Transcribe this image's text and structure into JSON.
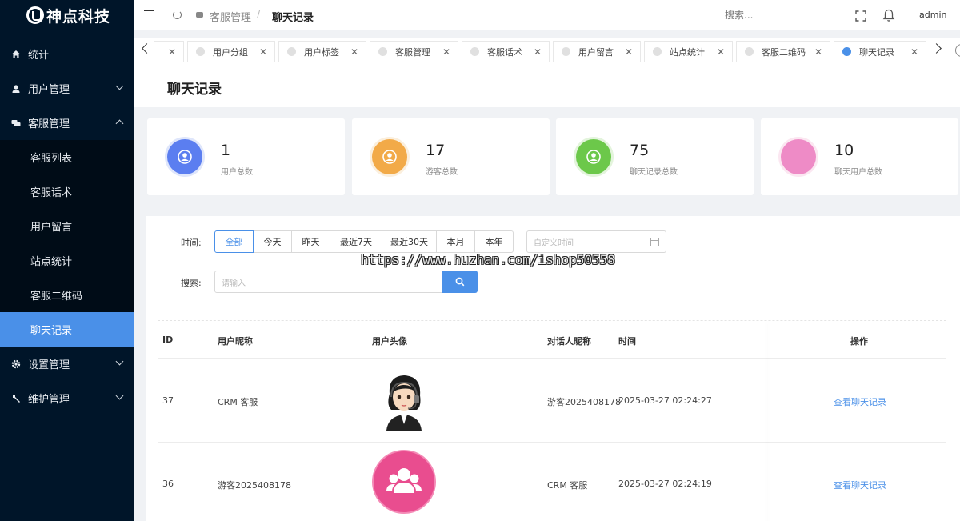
{
  "app": {
    "logo_text": "神点科技"
  },
  "sidebar": {
    "items": [
      {
        "label": "统计",
        "icon": "home-icon"
      },
      {
        "label": "用户管理",
        "icon": "user-icon"
      },
      {
        "label": "客服管理",
        "icon": "chat-icon"
      }
    ],
    "sub_items": [
      "客服列表",
      "客服话术",
      "用户留言",
      "站点统计",
      "客服二维码",
      "聊天记录"
    ],
    "active_sub": "聊天记录",
    "bottom_items": [
      {
        "label": "设置管理",
        "icon": "gear-icon"
      },
      {
        "label": "维护管理",
        "icon": "tool-icon"
      }
    ]
  },
  "header": {
    "breadcrumb_parent": "客服管理",
    "breadcrumb_sep": "/",
    "breadcrumb_current": "聊天记录",
    "search_placeholder": "搜索...",
    "user": "admin"
  },
  "tabs": [
    {
      "label": "",
      "active": false
    },
    {
      "label": "用户分组",
      "active": false
    },
    {
      "label": "用户标签",
      "active": false
    },
    {
      "label": "客服管理",
      "active": false
    },
    {
      "label": "客服话术",
      "active": false
    },
    {
      "label": "用户留言",
      "active": false
    },
    {
      "label": "站点统计",
      "active": false
    },
    {
      "label": "客服二维码",
      "active": false
    },
    {
      "label": "聊天记录",
      "active": true
    }
  ],
  "page": {
    "title": "聊天记录"
  },
  "stats": [
    {
      "value": "1",
      "label": "用户总数",
      "color": "#5b7ef0",
      "ring": "#dfe6fb"
    },
    {
      "value": "17",
      "label": "游客总数",
      "color": "#f2aa48",
      "ring": "#fbefdd"
    },
    {
      "value": "75",
      "label": "聊天记录总数",
      "color": "#6cc84a",
      "ring": "#e3f4dc"
    },
    {
      "value": "10",
      "label": "聊天用户总数",
      "color": "#ee8bc6",
      "ring": "#fbe7f1"
    }
  ],
  "filter": {
    "time_label": "时间:",
    "time_options": [
      "全部",
      "今天",
      "昨天",
      "最近7天",
      "最近30天",
      "本月",
      "本年"
    ],
    "active_option": "全部",
    "date_placeholder": "自定义时间",
    "search_label": "搜索:",
    "search_placeholder": "请输入"
  },
  "watermark": "https://www.huzhan.com/ishop50558",
  "table": {
    "columns": [
      "ID",
      "用户昵称",
      "用户头像",
      "对话人昵称",
      "时间",
      "操作"
    ],
    "rows": [
      {
        "id": "37",
        "nickname": "CRM 客服",
        "avatar": "agent-avatar",
        "partner": "游客2025408178",
        "time": "2025-03-27 02:24:27",
        "action": "查看聊天记录"
      },
      {
        "id": "36",
        "nickname": "游客2025408178",
        "avatar": "guest-avatar",
        "partner": "CRM 客服",
        "time": "2025-03-27 02:24:19",
        "action": "查看聊天记录"
      }
    ]
  }
}
